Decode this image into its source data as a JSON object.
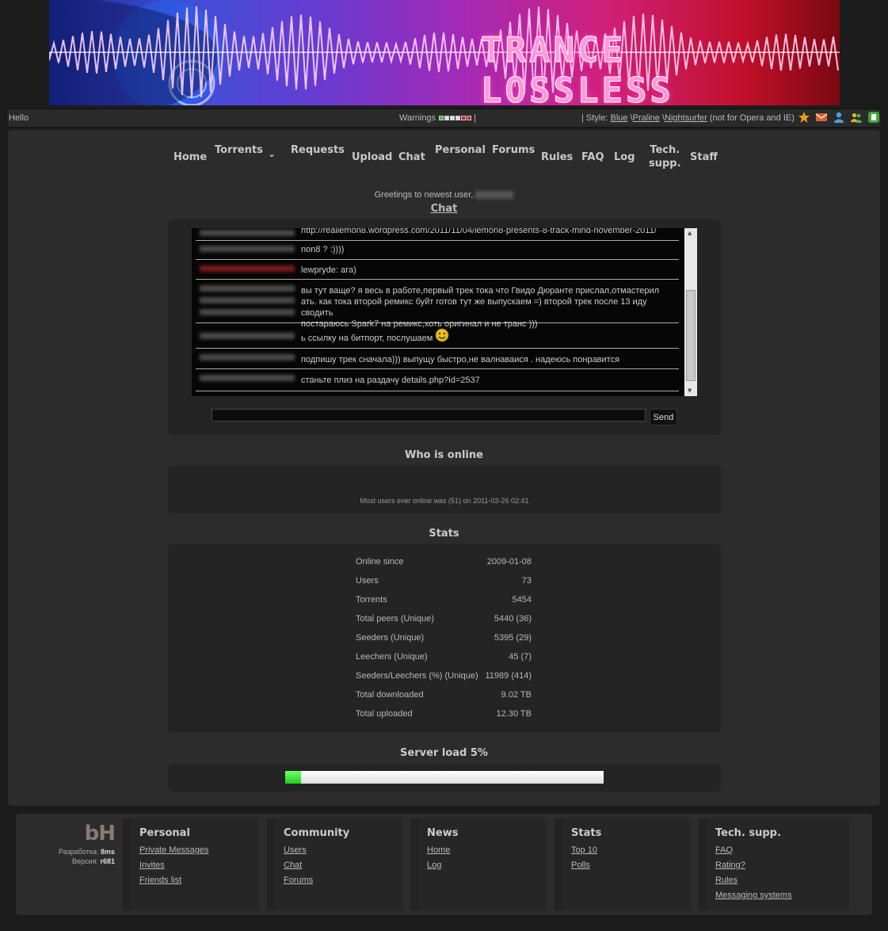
{
  "banner": {
    "title": "TRANCE LOSSLESS"
  },
  "topbar": {
    "hello": "Hello",
    "warnings_label": "Warnings",
    "warning_colors": [
      "#33cc33",
      "#dddddd",
      "#dddddd",
      "#dddddd",
      "#cc2222",
      "#cc2222"
    ],
    "style_prefix": "| Style:",
    "styles": [
      "Blue",
      "Praline",
      "Nightsurfer"
    ],
    "style_sep": "\\",
    "style_note": "(not for Opera and IE)",
    "icons": [
      "star-icon",
      "mail-icon",
      "user-icon",
      "friends-icon",
      "rss-icon"
    ]
  },
  "nav": {
    "home": "Home",
    "torrents": "Torrents",
    "torrents_arrow": "⌄",
    "requests": "Requests",
    "upload": "Upload",
    "chat": "Chat",
    "personal": "Personal",
    "forums": "Forums",
    "rules": "Rules",
    "faq": "FAQ",
    "log": "Log",
    "techsupp_1": "Tech.",
    "techsupp_2": "supp.",
    "staff": "Staff"
  },
  "greeting": "Greetings to newest user,",
  "chat": {
    "title": "Chat",
    "messages": [
      "http://realiemon8.wordpress.com/2011/11/04/lemon8-presents-8-track-mind-november-2011/",
      "non8 ? :))))",
      "lewpryde: ага)",
      "вы тут ваще? я весь в работе,первый трек тока что Гвидо Дюранте прислал,отмастерил\nать. как тока второй ремикс буйт готов тут же выпускаем =) второй трек после 13 иду сводить\nпостараюсь Spark7 на ремикс,хоть оригинал и не транс )))",
      "ь ссылку на битпорт, послушаем",
      "подпишу трек сначала))) выпущу быстро,не валнаваися . надеюсь понравится",
      "станьте плиз на раздачу details.php?id=2537"
    ],
    "send_label": "Send"
  },
  "who_online": {
    "title": "Who is online",
    "max_note": "Most users ever online was (51) on 2011-03-26 02:41"
  },
  "stats": {
    "title": "Stats",
    "rows": [
      {
        "label": "Online since",
        "value": "2009-01-08"
      },
      {
        "label": "Users",
        "value": "73"
      },
      {
        "label": "Torrents",
        "value": "5454"
      },
      {
        "label": "Total peers (Unique)",
        "value": "5440 (36)"
      },
      {
        "label": "Seeders (Unique)",
        "value": "5395 (29)"
      },
      {
        "label": "Leechers (Unique)",
        "value": "45 (7)"
      },
      {
        "label": "Seeders/Leechers (%) (Unique)",
        "value": "11989 (414)"
      },
      {
        "label": "Total downloaded",
        "value": "9.02 TB"
      },
      {
        "label": "Total uploaded",
        "value": "12.30 TB"
      }
    ]
  },
  "server_load": {
    "title": "Server load 5%",
    "percent": 5
  },
  "footer": {
    "logo": "bH",
    "dev_label": "Разработка:",
    "dev_value": "8ms",
    "version_label": "Версия:",
    "version_value": "r681",
    "columns": [
      {
        "title": "Personal",
        "links": [
          "Private Messages",
          "Invites",
          "Friends list"
        ]
      },
      {
        "title": "Community",
        "links": [
          "Users",
          "Chat",
          "Forums"
        ]
      },
      {
        "title": "News",
        "links": [
          "Home",
          "Log"
        ]
      },
      {
        "title": "Stats",
        "links": [
          "Top 10",
          "Polls"
        ]
      },
      {
        "title": "Tech. supp.",
        "links": [
          "FAQ",
          "Rating?",
          "Rules",
          "Messaging systems"
        ]
      }
    ]
  }
}
